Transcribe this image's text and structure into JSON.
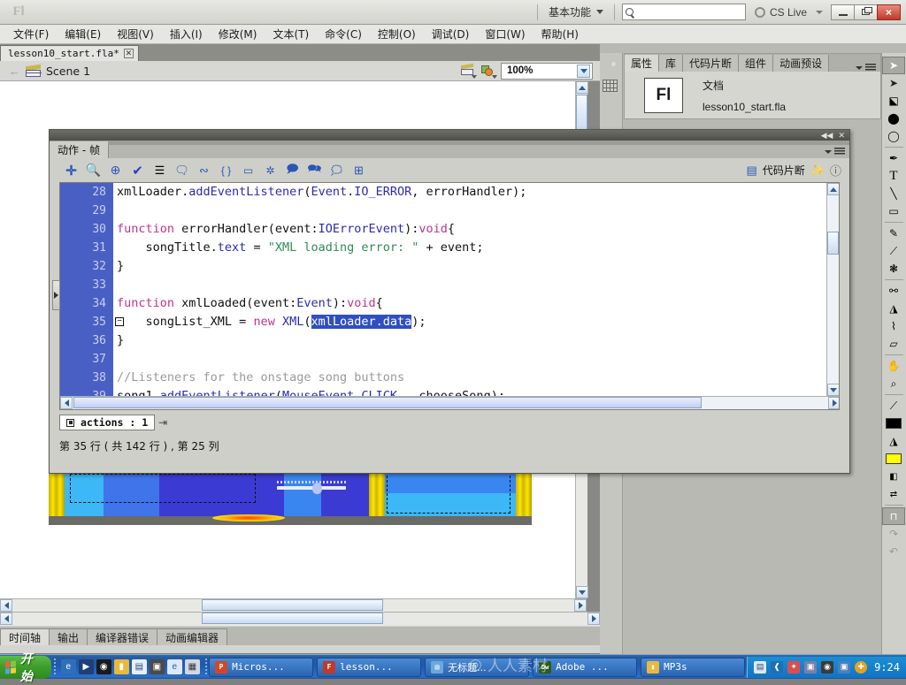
{
  "titlebar": {
    "app_logo": "Fl",
    "workspace": "基本功能",
    "search_placeholder": "",
    "search_value": "",
    "cslive_label": "CS Live",
    "minimize": "minimize-icon",
    "restore": "restore-icon",
    "close": "×"
  },
  "menubar": {
    "items": [
      {
        "label": "文件(F)"
      },
      {
        "label": "编辑(E)"
      },
      {
        "label": "视图(V)"
      },
      {
        "label": "插入(I)"
      },
      {
        "label": "修改(M)"
      },
      {
        "label": "文本(T)"
      },
      {
        "label": "命令(C)"
      },
      {
        "label": "控制(O)"
      },
      {
        "label": "调试(D)"
      },
      {
        "label": "窗口(W)"
      },
      {
        "label": "帮助(H)"
      }
    ]
  },
  "doctab": {
    "label": "lesson10_start.fla*",
    "close": "✕"
  },
  "scenebar": {
    "scene_label": "Scene 1",
    "zoom_value": "100%"
  },
  "actions_panel": {
    "tab_label": "动作 - 帧",
    "snippets_label": "代码片断",
    "collapse": "◀◀",
    "close": "✕",
    "toolbar_icons": [
      "add-item-icon",
      "find-icon",
      "insert-target-path-icon",
      "check-syntax-icon",
      "auto-format-icon",
      "show-code-hint-icon",
      "debug-options-icon",
      "collapse-between-braces-icon",
      "collapse-selection-icon",
      "expand-all-icon",
      "apply-block-comment-icon",
      "apply-line-comment-icon",
      "remove-comment-icon",
      "show-hide-toolbox-icon"
    ],
    "pin_label": "actions : 1",
    "status_text": "第 35 行 ( 共 142 行 ) , 第 25 列",
    "code": [
      {
        "num": "28",
        "fold": false,
        "segments": [
          {
            "t": "xmlLoader.",
            "c": "plain"
          },
          {
            "t": "addEventListener",
            "c": "cls"
          },
          {
            "t": "(",
            "c": "plain"
          },
          {
            "t": "Event",
            "c": "cls"
          },
          {
            "t": ".",
            "c": "plain"
          },
          {
            "t": "IO_ERROR",
            "c": "cls"
          },
          {
            "t": ", errorHandler);",
            "c": "plain"
          }
        ]
      },
      {
        "num": "29",
        "fold": false,
        "segments": []
      },
      {
        "num": "30",
        "fold": false,
        "segments": [
          {
            "t": "function",
            "c": "kw"
          },
          {
            "t": " errorHandler(event:",
            "c": "plain"
          },
          {
            "t": "IOErrorEvent",
            "c": "cls"
          },
          {
            "t": "):",
            "c": "plain"
          },
          {
            "t": "void",
            "c": "kw"
          },
          {
            "t": "{",
            "c": "plain"
          }
        ]
      },
      {
        "num": "31",
        "fold": false,
        "segments": [
          {
            "t": "    songTitle.",
            "c": "plain"
          },
          {
            "t": "text",
            "c": "cls"
          },
          {
            "t": " = ",
            "c": "plain"
          },
          {
            "t": "\"XML loading error: \"",
            "c": "str"
          },
          {
            "t": " + event;",
            "c": "plain"
          }
        ]
      },
      {
        "num": "32",
        "fold": false,
        "segments": [
          {
            "t": "}",
            "c": "plain"
          }
        ]
      },
      {
        "num": "33",
        "fold": false,
        "segments": []
      },
      {
        "num": "34",
        "fold": false,
        "segments": [
          {
            "t": "function",
            "c": "kw"
          },
          {
            "t": " xmlLoaded(event:",
            "c": "plain"
          },
          {
            "t": "Event",
            "c": "cls"
          },
          {
            "t": "):",
            "c": "plain"
          },
          {
            "t": "void",
            "c": "kw"
          },
          {
            "t": "{",
            "c": "plain"
          }
        ]
      },
      {
        "num": "35",
        "fold": true,
        "segments": [
          {
            "t": "    songList_XML = ",
            "c": "plain"
          },
          {
            "t": "new",
            "c": "kw"
          },
          {
            "t": " ",
            "c": "plain"
          },
          {
            "t": "XML",
            "c": "cls"
          },
          {
            "t": "(",
            "c": "plain"
          },
          {
            "t": "xmlLoader.data",
            "c": "sel"
          },
          {
            "t": ");",
            "c": "plain"
          }
        ]
      },
      {
        "num": "36",
        "fold": false,
        "segments": [
          {
            "t": "}",
            "c": "plain"
          }
        ]
      },
      {
        "num": "37",
        "fold": false,
        "segments": []
      },
      {
        "num": "38",
        "fold": false,
        "segments": [
          {
            "t": "//Listeners for the onstage song buttons",
            "c": "cmt"
          }
        ]
      },
      {
        "num": "39",
        "fold": false,
        "segments": [
          {
            "t": "song1.",
            "c": "plain"
          },
          {
            "t": "addEventListener",
            "c": "cls"
          },
          {
            "t": "(",
            "c": "plain"
          },
          {
            "t": "MouseEvent",
            "c": "cls"
          },
          {
            "t": ".",
            "c": "plain"
          },
          {
            "t": "CLICK",
            "c": "cls"
          },
          {
            "t": ",  chooseSong);",
            "c": "plain"
          }
        ]
      }
    ]
  },
  "properties_panel": {
    "tabs": [
      {
        "label": "属性",
        "active": true
      },
      {
        "label": "库",
        "active": false
      },
      {
        "label": "代码片断",
        "active": false
      },
      {
        "label": "组件",
        "active": false
      },
      {
        "label": "动画预设",
        "active": false
      }
    ],
    "thumb_label": "Fl",
    "doc_label": "文档",
    "filename": "lesson10_start.fla"
  },
  "dock_icons": [
    {
      "name": "palette-icon"
    },
    {
      "name": "grid-icon"
    }
  ],
  "tools_panel": {
    "tools": [
      {
        "name": "selection-tool",
        "glyph": "➤",
        "selected": true
      },
      {
        "name": "subselection-tool",
        "glyph": "➤",
        "selected": false
      },
      {
        "name": "free-transform-tool",
        "glyph": "◳",
        "selected": false
      },
      {
        "name": "3d-rotation-tool",
        "glyph": "●",
        "selected": false
      },
      {
        "name": "lasso-tool",
        "glyph": "◯",
        "selected": false
      },
      {
        "name": "pen-tool",
        "glyph": "✒",
        "selected": false
      },
      {
        "name": "text-tool",
        "glyph": "T",
        "selected": false
      },
      {
        "name": "line-tool",
        "glyph": "╱",
        "selected": false
      },
      {
        "name": "rectangle-tool",
        "glyph": "▭",
        "selected": false
      },
      {
        "name": "pencil-tool",
        "glyph": "✎",
        "selected": false
      },
      {
        "name": "brush-tool",
        "glyph": "🖌",
        "selected": false
      },
      {
        "name": "deco-tool",
        "glyph": "✿",
        "selected": false
      },
      {
        "name": "bone-tool",
        "glyph": "⚯",
        "selected": false
      },
      {
        "name": "paint-bucket-tool",
        "glyph": "▞",
        "selected": false
      },
      {
        "name": "eyedropper-tool",
        "glyph": "⌁",
        "selected": false
      },
      {
        "name": "eraser-tool",
        "glyph": "▱",
        "selected": false
      },
      {
        "name": "hand-tool",
        "glyph": "✋",
        "selected": false
      },
      {
        "name": "zoom-tool",
        "glyph": "🔍",
        "selected": false
      }
    ],
    "stroke_color": "#000000",
    "fill_color": "#ffff00",
    "snap_to_objects": "magnet-icon"
  },
  "bottom_tabs": [
    {
      "label": "时间轴",
      "active": true
    },
    {
      "label": "输出",
      "active": false
    },
    {
      "label": "编译器错误",
      "active": false
    },
    {
      "label": "动画编辑器",
      "active": false
    }
  ],
  "taskbar": {
    "start_label": "开始",
    "quicklaunch": [
      {
        "name": "ie-quicklaunch-icon",
        "color": "#2d6fba",
        "glyph": "e"
      },
      {
        "name": "media-player-icon",
        "color": "#1f3f78",
        "glyph": "▶"
      },
      {
        "name": "browser-icon",
        "color": "#1a1a1a",
        "glyph": "◉"
      },
      {
        "name": "folder-icon",
        "color": "#e8b93c",
        "glyph": "▮"
      },
      {
        "name": "notepad-icon",
        "color": "#e8eef6",
        "glyph": "▤"
      },
      {
        "name": "camera-icon",
        "color": "#4a4a4a",
        "glyph": "▣"
      },
      {
        "name": "internet-explorer-icon",
        "color": "#dce8f6",
        "glyph": "e"
      },
      {
        "name": "calculator-icon",
        "color": "#cfd8e4",
        "glyph": "▦"
      }
    ],
    "windows": [
      {
        "label": "Micros...",
        "icon_color": "#d24726",
        "icon_glyph": "P"
      },
      {
        "label": "lesson...",
        "icon_color": "#c0392b",
        "icon_glyph": "F"
      },
      {
        "label": "无标题...",
        "icon_color": "#6aa8dd",
        "icon_glyph": "▤"
      },
      {
        "label": "Adobe ...",
        "icon_color": "#2b5b1f",
        "icon_glyph": "Dw"
      },
      {
        "label": "MP3s",
        "icon_color": "#e8b93c",
        "icon_glyph": "▮"
      }
    ],
    "tray": [
      {
        "name": "keyboard-layout-icon",
        "color": "#dfe8f2",
        "glyph": "▤"
      },
      {
        "name": "shield-icon",
        "color": "#1f6fb5",
        "glyph": "❰"
      },
      {
        "name": "colorful-icon",
        "color": "#d94f4f",
        "glyph": "✦"
      },
      {
        "name": "network-icon",
        "color": "#7a7fa8",
        "glyph": "▣"
      },
      {
        "name": "volume-icon",
        "color": "#3a3a3a",
        "glyph": "◉"
      },
      {
        "name": "monitor-icon",
        "color": "#4a7fc0",
        "glyph": "▣"
      },
      {
        "name": "update-icon",
        "color": "#e8a020",
        "glyph": "✚"
      }
    ],
    "clock": "9:24"
  },
  "watermark": "人人素材"
}
